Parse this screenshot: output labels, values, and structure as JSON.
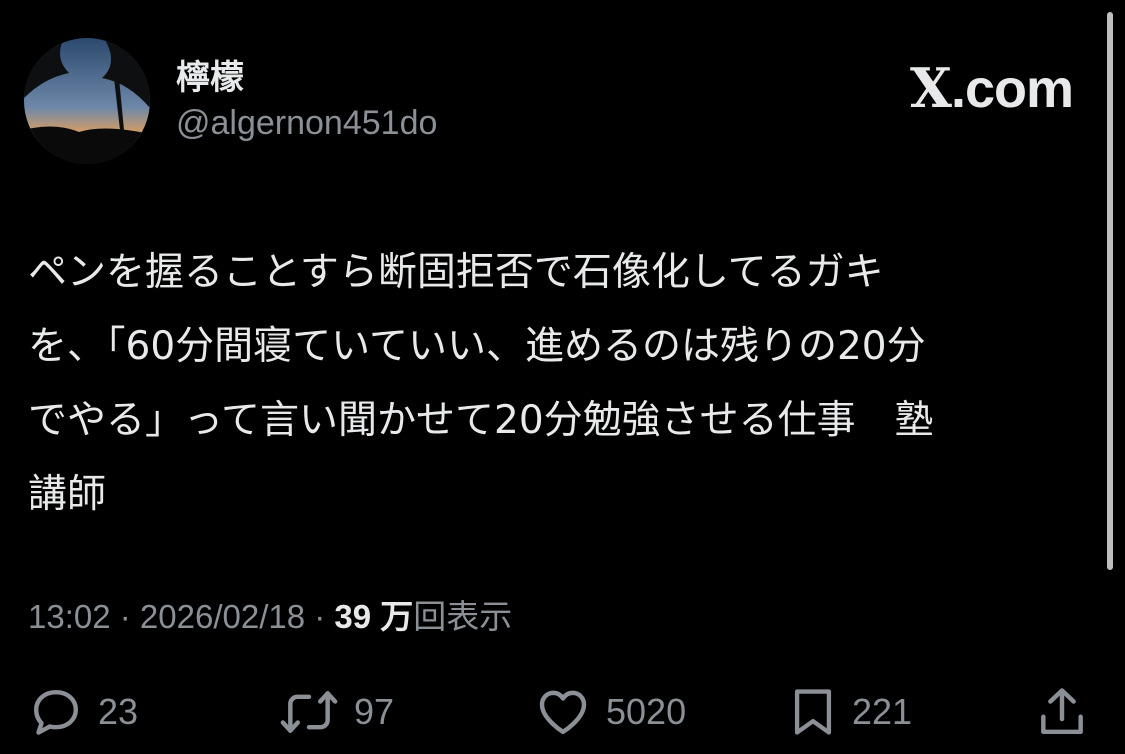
{
  "user": {
    "display_name": "檸檬",
    "handle": "@algernon451do"
  },
  "brand": {
    "logo": "X",
    "suffix": ".com"
  },
  "tweet": {
    "lines": [
      "ペンを握ることすら断固拒否で石像化してるガキ",
      "を、「60分間寝ていていい、進めるのは残りの20分",
      "でやる」って言い聞かせて20分勉強させる仕事　塾",
      "講師"
    ]
  },
  "meta": {
    "time": "13:02",
    "sep1": " · ",
    "date": "2026/02/18",
    "sep2": " · ",
    "views_count": "39 万",
    "views_label": "回表示"
  },
  "actions": {
    "reply_count": "23",
    "retweet_count": "97",
    "like_count": "5020",
    "bookmark_count": "221"
  },
  "icons": {
    "reply": "reply-icon",
    "retweet": "retweet-icon",
    "like": "heart-icon",
    "bookmark": "bookmark-icon",
    "share": "share-icon"
  },
  "colors": {
    "background": "#000000",
    "text": "#e7e9ea",
    "secondary": "#8b9096"
  }
}
